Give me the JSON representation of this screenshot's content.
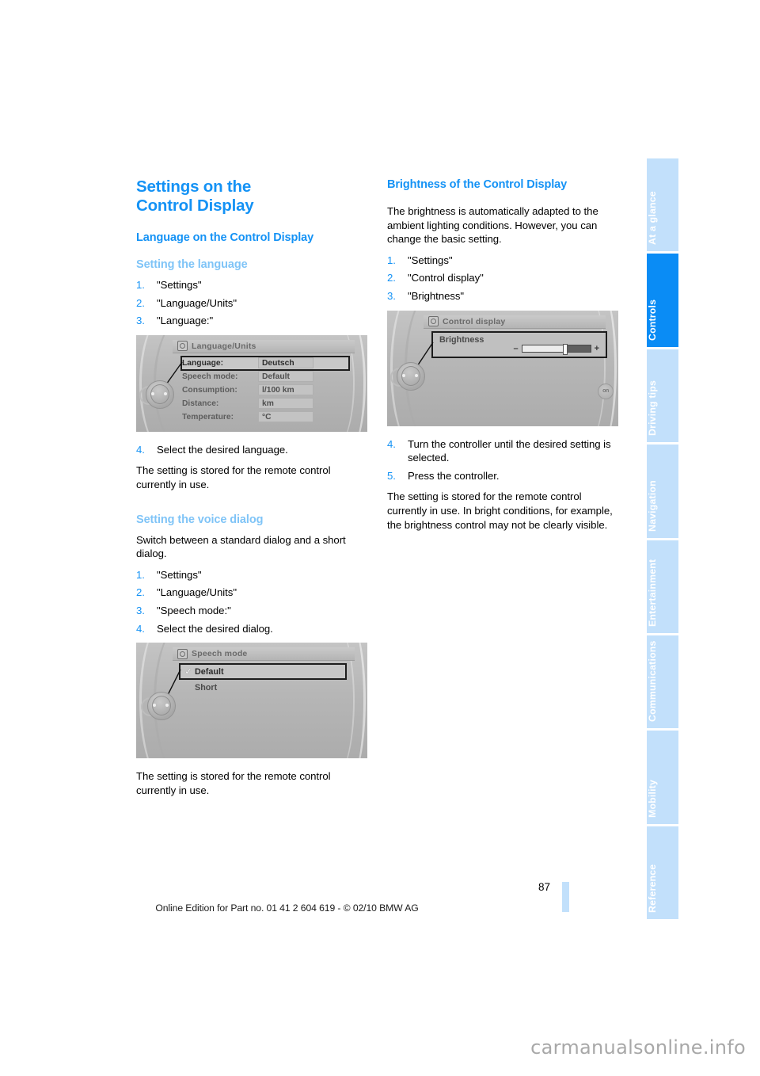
{
  "document": {
    "page_number": "87",
    "footer_note": "Online Edition for Part no. 01 41 2 604 619 - © 02/10 BMW AG",
    "watermark": "carmanualsonline.info",
    "accent_color": "#1492f5",
    "subheading_color": "#7fc4f7",
    "tab_active_color": "#0a8cf5",
    "tab_inactive_color": "#c2e0fb"
  },
  "left_column": {
    "chapter_title_line1": "Settings on the",
    "chapter_title_line2": "Control Display",
    "section_title": "Language on the Control Display",
    "sub1": {
      "title": "Setting the language",
      "steps": [
        {
          "num": "1.",
          "text": "\"Settings\""
        },
        {
          "num": "2.",
          "text": "\"Language/Units\""
        },
        {
          "num": "3.",
          "text": "\"Language:\""
        }
      ],
      "steps_after": [
        {
          "num": "4.",
          "text": "Select the desired language."
        }
      ],
      "note": "The setting is stored for the remote control currently in use."
    },
    "sub2": {
      "title": "Setting the voice dialog",
      "intro": "Switch between a standard dialog and a short dialog.",
      "steps": [
        {
          "num": "1.",
          "text": "\"Settings\""
        },
        {
          "num": "2.",
          "text": "\"Language/Units\""
        },
        {
          "num": "3.",
          "text": "\"Speech mode:\""
        },
        {
          "num": "4.",
          "text": "Select the desired dialog."
        }
      ],
      "note": "The setting is stored for the remote control currently in use."
    }
  },
  "right_column": {
    "section_title": "Brightness of the Control Display",
    "intro": "The brightness is automatically adapted to the ambient lighting conditions. However, you can change the basic setting.",
    "steps": [
      {
        "num": "1.",
        "text": "\"Settings\""
      },
      {
        "num": "2.",
        "text": "\"Control display\""
      },
      {
        "num": "3.",
        "text": "\"Brightness\""
      }
    ],
    "steps_after": [
      {
        "num": "4.",
        "text": "Turn the controller until the desired setting is selected."
      },
      {
        "num": "5.",
        "text": "Press the controller."
      }
    ],
    "note": "The setting is stored for the remote control currently in use. In bright conditions, for example, the brightness control may not be clearly visible."
  },
  "figures": {
    "language_units": {
      "title": "Language/Units",
      "rows": [
        {
          "label": "Language:",
          "value": "Deutsch",
          "selected": true
        },
        {
          "label": "Speech mode:",
          "value": "Default",
          "selected": false
        },
        {
          "label": "Consumption:",
          "value": "l/100 km",
          "selected": false
        },
        {
          "label": "Distance:",
          "value": "km",
          "selected": false
        },
        {
          "label": "Temperature:",
          "value": "°C",
          "selected": false
        }
      ]
    },
    "speech_mode": {
      "title": "Speech mode",
      "choices": [
        {
          "check": "✓",
          "text": "Default",
          "selected": true
        },
        {
          "check": "",
          "text": "Short",
          "selected": false
        }
      ]
    },
    "control_display": {
      "title": "Control display",
      "slider_label": "Brightness",
      "minus": "–",
      "plus": "+",
      "fill_percent": 62,
      "on_badge": "on"
    }
  },
  "sidebar": {
    "tabs": [
      {
        "label": "At a glance",
        "active": false
      },
      {
        "label": "Controls",
        "active": true
      },
      {
        "label": "Driving tips",
        "active": false
      },
      {
        "label": "Navigation",
        "active": false
      },
      {
        "label": "Entertainment",
        "active": false
      },
      {
        "label": "Communications",
        "active": false
      },
      {
        "label": "Mobility",
        "active": false
      },
      {
        "label": "Reference",
        "active": false
      }
    ]
  }
}
